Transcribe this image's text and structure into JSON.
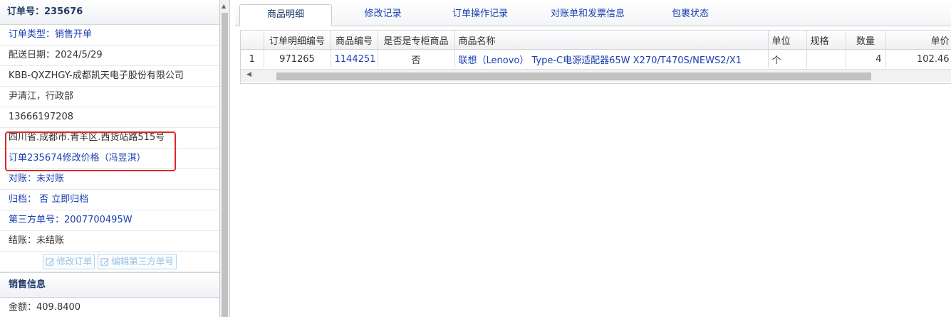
{
  "order": {
    "header": "订单号：235676",
    "type": "订单类型：销售开单",
    "delivery_date": "配送日期：2024/5/29",
    "company": "KBB-QXZHGY-成都凯天电子股份有限公司",
    "contact": "尹清江，行政部",
    "phone": "13666197208",
    "address": "四川省.成都市.青羊区.西货站路515号",
    "note": "订单235674修改价格（冯昱淇）",
    "reconcile": "对账：未对账",
    "archive": "归档： 否 立即归档",
    "third_party": "第三方单号：2007700495W",
    "settlement": "结账：未结账",
    "btn_edit": "修改订单",
    "btn_edit_third": "编辑第三方单号"
  },
  "sales": {
    "header": "销售信息",
    "amount": "金额：409.8400"
  },
  "tabs": [
    "商品明细",
    "修改记录",
    "订单操作记录",
    "对账单和发票信息",
    "包裹状态"
  ],
  "table": {
    "columns": [
      "",
      "订单明细编号",
      "商品编号",
      "是否是专柜商品",
      "商品名称",
      "单位",
      "规格",
      "数量",
      "单价"
    ],
    "rows": [
      [
        "1",
        "971265",
        "1144251",
        "否",
        "联想（Lenovo） Type-C电源适配器65W X270/T470S/NEWS2/X1",
        "个",
        "",
        "4",
        "102.46"
      ]
    ]
  },
  "colors": {
    "accent": "#1a3fb0",
    "highlight": "#e0262b"
  },
  "icons": {
    "edit": "edit-icon"
  }
}
